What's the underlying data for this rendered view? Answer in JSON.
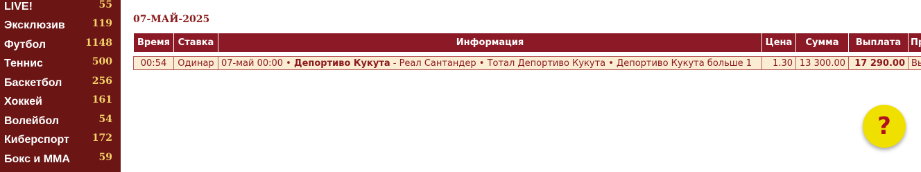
{
  "sidebar": {
    "items": [
      {
        "label": "LIVE!",
        "count": "55"
      },
      {
        "label": "Эксклюзив",
        "count": "119"
      },
      {
        "label": "Футбол",
        "count": "1148"
      },
      {
        "label": "Теннис",
        "count": "500"
      },
      {
        "label": "Баскетбол",
        "count": "256"
      },
      {
        "label": "Хоккей",
        "count": "161"
      },
      {
        "label": "Волейбол",
        "count": "54"
      },
      {
        "label": "Киберспорт",
        "count": "172"
      },
      {
        "label": "Бокс и MMA",
        "count": "59"
      }
    ]
  },
  "main": {
    "date": "07-МАЙ-2025",
    "table": {
      "headers": {
        "time": "Время",
        "bet_type": "Ставка",
        "info": "Информация",
        "price": "Цена",
        "amount": "Сумма",
        "payout": "Выплата",
        "extra": "Пр"
      },
      "rows": [
        {
          "time": "00:54",
          "bet_type": "Одинар",
          "info_prefix": "07-май 00:00 • ",
          "info_team": "Депортиво Кукута",
          "info_rest": " - Реал Сантандер • Тотал Депортиво Кукута • Депортиво Кукута больше 1",
          "price": "1.30",
          "amount": "13 300.00",
          "payout": "17 290.00",
          "extra": "Вы"
        }
      ]
    }
  },
  "help": {
    "symbol": "?"
  },
  "colors": {
    "sidebar_bg": "#6b1515",
    "sidebar_count": "#f4d46a",
    "header_bg": "#8b1a26",
    "row_bg": "#fbecd4",
    "accent_text": "#8b1a1a",
    "help_bg": "#f0e000",
    "help_symbol": "#b01020"
  }
}
